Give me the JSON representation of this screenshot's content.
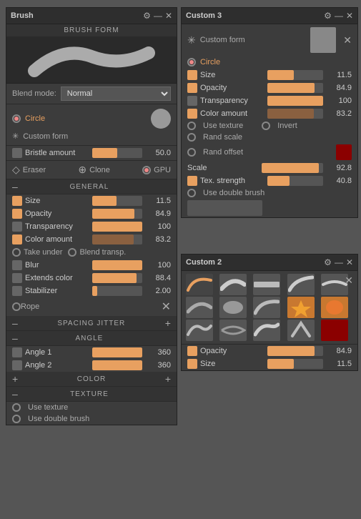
{
  "brush_panel": {
    "title": "Brush",
    "section_brush_form": "BRUSH FORM",
    "blend_mode_label": "Blend mode:",
    "blend_mode_value": "Normal",
    "form_circle": "Circle",
    "form_custom": "Custom form",
    "bristle_label": "Bristle amount",
    "bristle_value": "50.0",
    "eraser_label": "Eraser",
    "clone_label": "Clone",
    "gpu_label": "GPU",
    "section_general": "GENERAL",
    "size_label": "Size",
    "size_value": "11.5",
    "opacity_label": "Opacity",
    "opacity_value": "84.9",
    "transparency_label": "Transparency",
    "transparency_value": "100",
    "color_amount_label": "Color amount",
    "color_amount_value": "83.2",
    "take_under_label": "Take under",
    "blend_transp_label": "Blend transp.",
    "blur_label": "Blur",
    "blur_value": "100",
    "extends_color_label": "Extends color",
    "extends_color_value": "88.4",
    "stabilizer_label": "Stabilizer",
    "stabilizer_value": "2.00",
    "rope_label": "Rope",
    "section_spacing_jitter": "SPACING JITTER",
    "section_angle": "ANGLE",
    "angle1_label": "Angle 1",
    "angle1_value": "360",
    "angle2_label": "Angle 2",
    "angle2_value": "360",
    "section_color": "COLOR",
    "section_texture": "TEXTURE",
    "use_texture_label": "Use texture",
    "use_double_brush_label": "Use double brush"
  },
  "custom3_panel": {
    "title": "Custom 3",
    "custom_form_label": "Custom form",
    "circle_label": "Circle",
    "size_label": "Size",
    "size_value": "11.5",
    "opacity_label": "Opacity",
    "opacity_value": "84.9",
    "transparency_label": "Transparency",
    "transparency_value": "100",
    "color_amount_label": "Color amount",
    "color_amount_value": "83.2",
    "use_texture_label": "Use texture",
    "invert_label": "Invert",
    "rand_scale_label": "Rand scale",
    "rand_offset_label": "Rand offset",
    "scale_label": "Scale",
    "scale_value": "92.8",
    "tex_strength_label": "Tex. strength",
    "tex_strength_value": "40.8",
    "use_double_brush_label": "Use double brush"
  },
  "custom2_panel": {
    "title": "Custom 2",
    "opacity_label": "Opacity",
    "opacity_value": "84.9",
    "size_label": "Size",
    "size_value": "11.5"
  },
  "sliders": {
    "size_pct": 48,
    "opacity_pct": 84,
    "transparency_pct": 100,
    "color_amount_pct": 83,
    "blur_pct": 100,
    "extends_color_pct": 88,
    "stabilizer_pct": 10,
    "bristle_pct": 50,
    "angle1_pct": 100,
    "angle2_pct": 100,
    "c3_size_pct": 48,
    "c3_opacity_pct": 84,
    "c3_transparency_pct": 100,
    "c3_color_amount_pct": 83,
    "c3_scale_pct": 93,
    "c3_tex_strength_pct": 40,
    "c2_opacity_pct": 84,
    "c2_size_pct": 48
  }
}
